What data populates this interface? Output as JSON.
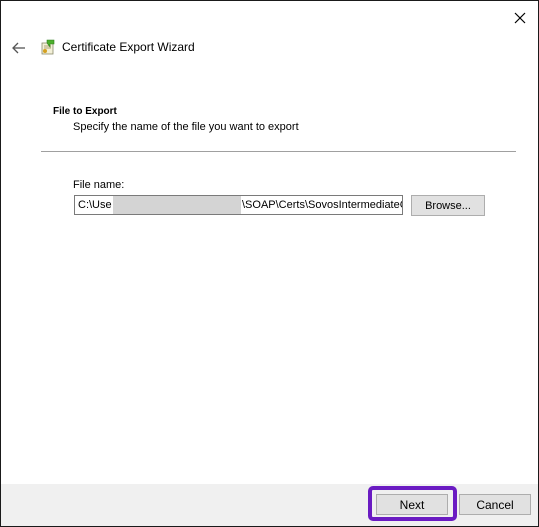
{
  "window": {
    "title": "Certificate Export Wizard"
  },
  "section": {
    "title": "File to Export",
    "subtitle": "Specify the name of the file you want to export"
  },
  "file": {
    "label": "File name:",
    "value_start": "C:\\Use",
    "value_end": "\\SOAP\\Certs\\SovosIntermediateC"
  },
  "buttons": {
    "browse": "Browse...",
    "next": "Next",
    "cancel": "Cancel"
  },
  "icons": {
    "close": "close-icon",
    "back": "back-arrow-icon",
    "wizard": "certificate-icon"
  },
  "colors": {
    "highlight": "#6a1bc2",
    "footer": "#f0f0f0",
    "button_face": "#e1e1e1"
  }
}
